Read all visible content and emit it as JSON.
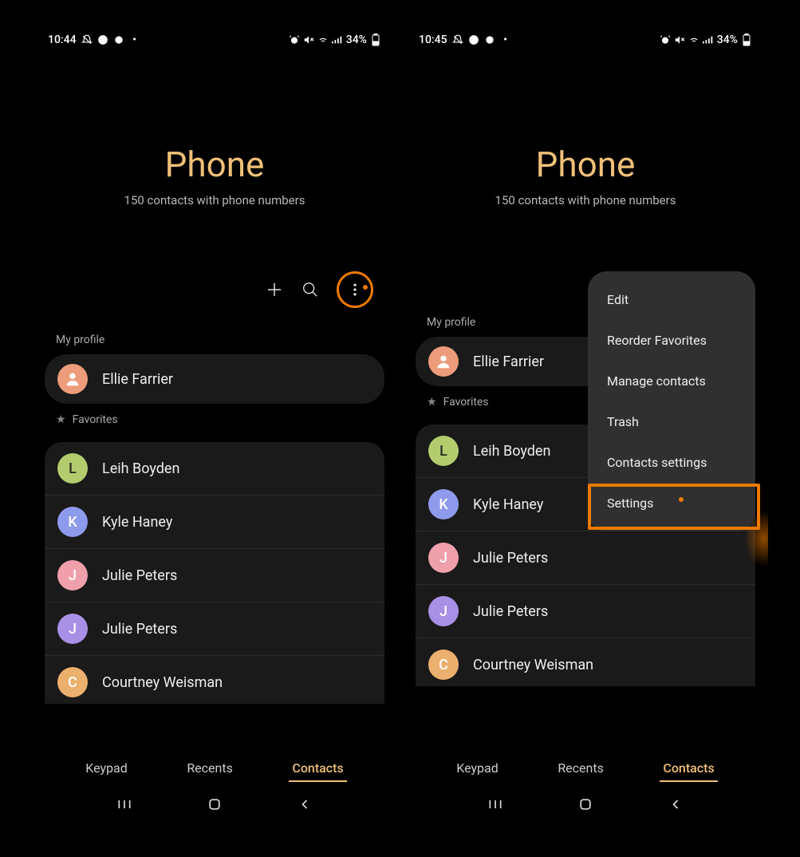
{
  "screens": [
    {
      "time": "10:44",
      "battery": "34%"
    },
    {
      "time": "10:45",
      "battery": "34%"
    }
  ],
  "header": {
    "title": "Phone",
    "subtitle": "150 contacts with phone numbers"
  },
  "sections": {
    "profile_label": "My profile",
    "favorites_label": "Favorites"
  },
  "profile": {
    "name": "Ellie Farrier"
  },
  "favorites": [
    {
      "initial": "L",
      "name": "Leih Boyden",
      "color": "av-green"
    },
    {
      "initial": "K",
      "name": "Kyle Haney",
      "color": "av-blue"
    },
    {
      "initial": "J",
      "name": "Julie Peters",
      "color": "av-pink"
    },
    {
      "initial": "J",
      "name": "Julie Peters",
      "color": "av-purple"
    },
    {
      "initial": "C",
      "name": "Courtney Weisman",
      "color": "av-orange"
    }
  ],
  "nav": {
    "keypad": "Keypad",
    "recents": "Recents",
    "contacts": "Contacts"
  },
  "menu": {
    "items": [
      "Edit",
      "Reorder Favorites",
      "Manage contacts",
      "Trash",
      "Contacts settings",
      "Settings"
    ]
  },
  "highlights": {
    "menu_button_circled": true,
    "settings_item_boxed": true
  }
}
